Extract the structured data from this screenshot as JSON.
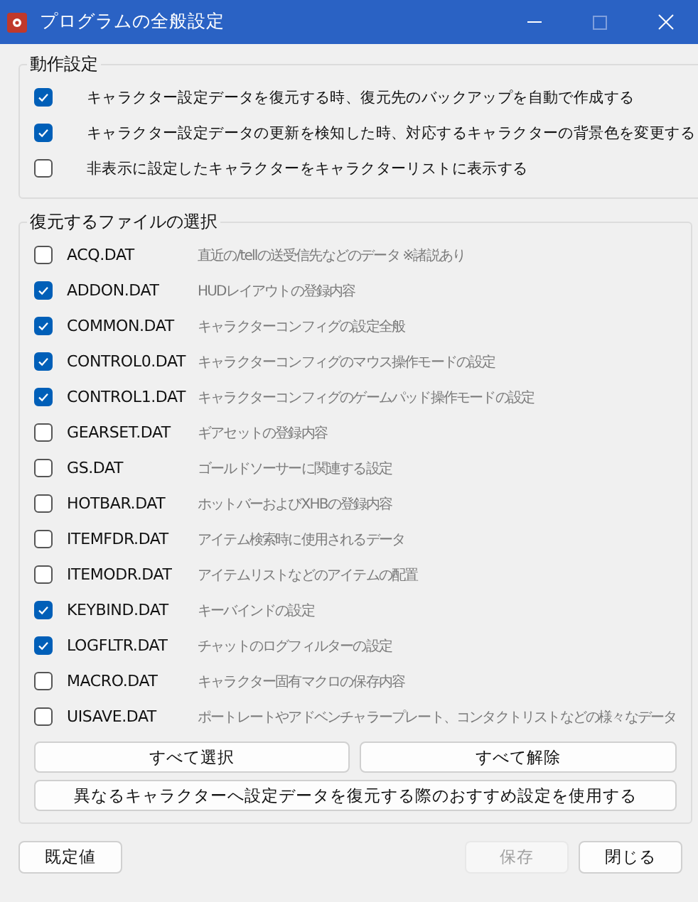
{
  "window": {
    "title": "プログラムの全般設定",
    "maximize_disabled": true
  },
  "behavior_group": {
    "legend": "動作設定",
    "options": [
      {
        "label": "キャラクター設定データを復元する時、復元先のバックアップを自動で作成する",
        "checked": true
      },
      {
        "label": "キャラクター設定データの更新を検知した時、対応するキャラクターの背景色を変更する",
        "checked": true
      },
      {
        "label": "非表示に設定したキャラクターをキャラクターリストに表示する",
        "checked": false
      }
    ]
  },
  "files_group": {
    "legend": "復元するファイルの選択",
    "files": [
      {
        "name": "ACQ.DAT",
        "description": "直近の/tellの送受信先などのデータ ※諸説あり",
        "checked": false
      },
      {
        "name": "ADDON.DAT",
        "description": "HUDレイアウトの登録内容",
        "checked": true
      },
      {
        "name": "COMMON.DAT",
        "description": "キャラクターコンフィグの設定全般",
        "checked": true
      },
      {
        "name": "CONTROL0.DAT",
        "description": "キャラクターコンフィグのマウス操作モードの設定",
        "checked": true
      },
      {
        "name": "CONTROL1.DAT",
        "description": "キャラクターコンフィグのゲームパッド操作モードの設定",
        "checked": true
      },
      {
        "name": "GEARSET.DAT",
        "description": "ギアセットの登録内容",
        "checked": false
      },
      {
        "name": "GS.DAT",
        "description": "ゴールドソーサーに関連する設定",
        "checked": false
      },
      {
        "name": "HOTBAR.DAT",
        "description": "ホットバーおよびXHBの登録内容",
        "checked": false
      },
      {
        "name": "ITEMFDR.DAT",
        "description": "アイテム検索時に使用されるデータ",
        "checked": false
      },
      {
        "name": "ITEMODR.DAT",
        "description": "アイテムリストなどのアイテムの配置",
        "checked": false
      },
      {
        "name": "KEYBIND.DAT",
        "description": "キーバインドの設定",
        "checked": true
      },
      {
        "name": "LOGFLTR.DAT",
        "description": "チャットのログフィルターの設定",
        "checked": true
      },
      {
        "name": "MACRO.DAT",
        "description": "キャラクター固有マクロの保存内容",
        "checked": false
      },
      {
        "name": "UISAVE.DAT",
        "description": "ポートレートやアドベンチャラープレート、コンタクトリストなどの様々なデータ",
        "checked": false
      }
    ],
    "select_all": "すべて選択",
    "clear_all": "すべて解除",
    "recommended": "異なるキャラクターへ設定データを復元する際のおすすめ設定を使用する"
  },
  "footer": {
    "left_buttons": [
      {
        "label": "既定値",
        "disabled": false
      }
    ],
    "right_buttons": [
      {
        "label": "保存",
        "disabled": true
      },
      {
        "label": "閉じる",
        "disabled": false
      }
    ]
  }
}
